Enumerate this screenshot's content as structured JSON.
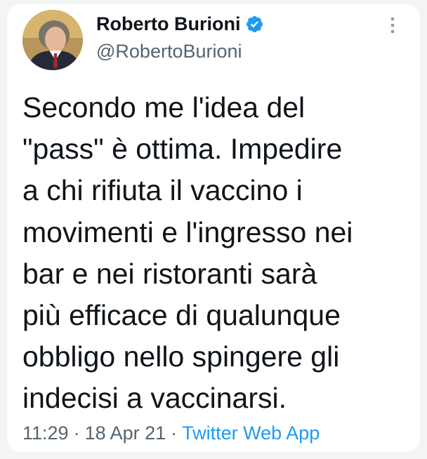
{
  "tweet": {
    "author": {
      "display_name": "Roberto Burioni",
      "handle": "@RobertoBurioni",
      "verified": true,
      "avatar_icon": "profile-photo",
      "verified_icon": "verified-badge-icon"
    },
    "text": "Secondo me l'idea del\n\"pass\" è ottima. Impedire\na chi rifiuta il vaccino i\nmovimenti e l'ingresso nei\nbar e nei ristoranti sarà\npiù efficace di qualunque\nobbligo nello spingere gli\nindecisi a vaccinarsi.",
    "time": "11:29",
    "date": "18 Apr 21",
    "separator": "·",
    "source": "Twitter Web App",
    "more_icon": "more-vertical-icon"
  },
  "colors": {
    "text_primary": "#0f1419",
    "text_secondary": "#536471",
    "accent": "#1d9bf0",
    "background": "#f3f4f4",
    "card": "#ffffff"
  }
}
